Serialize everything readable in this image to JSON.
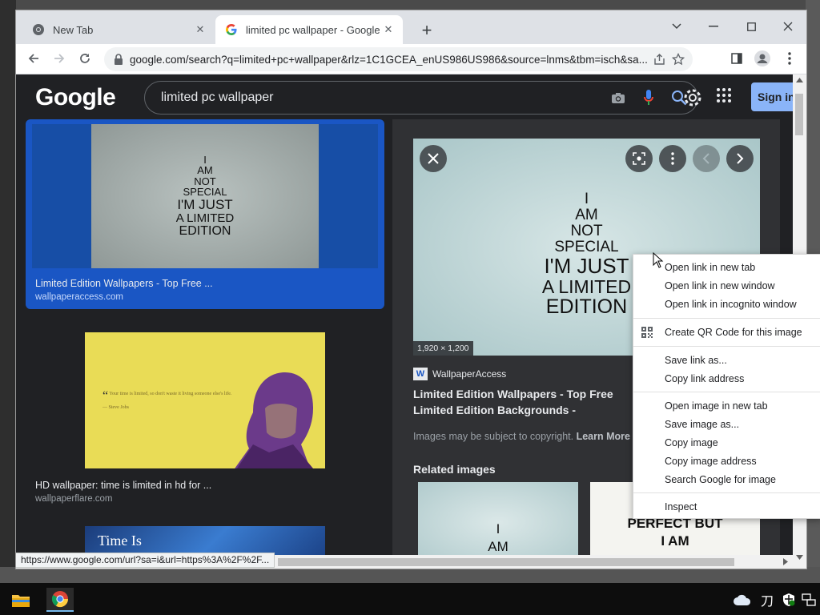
{
  "browser": {
    "tabs": [
      {
        "label": "New Tab",
        "icon": "chrome-icon",
        "active": false
      },
      {
        "label": "limited pc wallpaper - Google Se",
        "icon": "google-g-icon",
        "active": true
      }
    ],
    "new_tab_symbol": "+",
    "window_controls": {
      "tabs_dropdown": "⌄",
      "minimize": "—",
      "maximize": "☐",
      "close": "✕"
    },
    "address": "google.com/search?q=limited+pc+wallpaper&rlz=1C1GCEA_enUS986US986&source=lnms&tbm=isch&sa...",
    "status_url": "https://www.google.com/url?sa=i&url=https%3A%2F%2F..."
  },
  "google": {
    "logo": "Google",
    "query": "limited pc wallpaper",
    "sign_in": "Sign in"
  },
  "results": [
    {
      "title": "Limited Edition Wallpapers - Top Free ...",
      "source": "wallpaperaccess.com",
      "selected": true,
      "image_lines": [
        "I",
        "AM",
        "NOT",
        "SPECIAL",
        "I'M JUST",
        "A LIMITED",
        "EDITION"
      ]
    },
    {
      "title": "HD wallpaper: time is limited in hd for ...",
      "source": "wallpaperflare.com",
      "selected": false,
      "image_quote": "Your time is limited, so don't waste it living someone else's life.",
      "image_author": "— Steve Jobs"
    },
    {
      "title": "",
      "source": "",
      "selected": false,
      "image_text": "Time Is"
    }
  ],
  "preview": {
    "image_lines": [
      "I",
      "AM",
      "NOT",
      "SPECIAL",
      "I'M JUST",
      "A LIMITED",
      "EDITION"
    ],
    "dimensions": "1,920 × 1,200",
    "site_name": "WallpaperAccess",
    "site_logo": "W",
    "title": "Limited Edition Wallpapers - Top Free Limited Edition Backgrounds - WallpaperAccess",
    "copyright": "Images may be subject to copyright.",
    "learn_more": "Learn More",
    "related_heading": "Related images",
    "related": [
      {
        "text": "I\nAM"
      },
      {
        "text": "I'M NOT\nPERFECT BUT\nI AM"
      }
    ]
  },
  "context_menu": {
    "groups": [
      [
        "Open link in new tab",
        "Open link in new window",
        "Open link in incognito window"
      ],
      [
        "Create QR Code for this image"
      ],
      [
        "Save link as...",
        "Copy link address"
      ],
      [
        "Open image in new tab",
        "Save image as...",
        "Copy image",
        "Copy image address",
        "Search Google for image"
      ],
      [
        "Inspect"
      ]
    ]
  },
  "taskbar": {
    "icons": [
      "file-explorer-icon",
      "chrome-icon"
    ],
    "tray": [
      "weather-icon",
      "ime-icon",
      "security-icon",
      "network-icon"
    ],
    "ime_label": "刀"
  },
  "colors": {
    "accent": "#8ab4f8",
    "selected_card": "#1a56c4",
    "page_bg": "#202124",
    "panel_bg": "#303134"
  }
}
